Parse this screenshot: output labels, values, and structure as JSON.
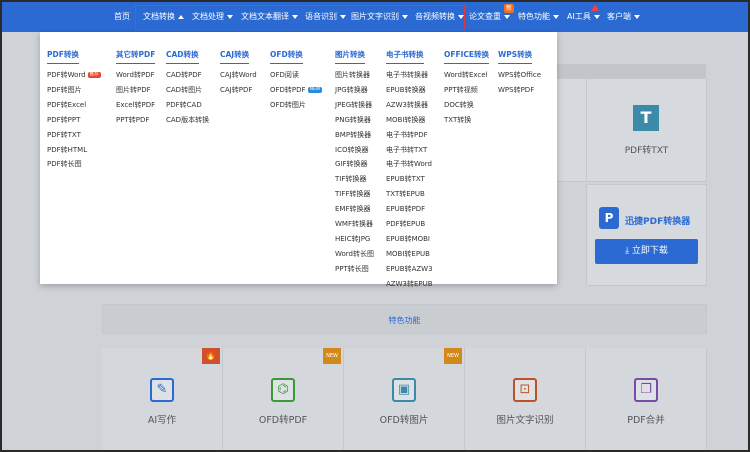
{
  "nav": {
    "items": [
      {
        "label": "首页",
        "arrow": "none"
      },
      {
        "label": "文档转换",
        "arrow": "up"
      },
      {
        "label": "文档处理",
        "arrow": "down"
      },
      {
        "label": "文档文本翻译",
        "arrow": "down"
      },
      {
        "label": "语音识别",
        "arrow": "down"
      },
      {
        "label": "图片文字识别",
        "arrow": "down"
      },
      {
        "label": "音视频转换",
        "arrow": "down"
      },
      {
        "label": "论文查重",
        "arrow": "down"
      },
      {
        "label": "特色功能",
        "arrow": "down"
      },
      {
        "label": "AI工具",
        "arrow": "down"
      },
      {
        "label": "客户端",
        "arrow": "down"
      }
    ],
    "new_badge": "新"
  },
  "dropdown": {
    "columns": [
      {
        "title": "PDF转换",
        "items": [
          "PDF转Word",
          "PDF转图片",
          "PDF转Excel",
          "PDF转PPT",
          "PDF转TXT",
          "PDF转HTML",
          "PDF转长图"
        ],
        "badge": "推荐"
      },
      {
        "title": "其它转PDF",
        "items": [
          "Word转PDF",
          "图片转PDF",
          "Excel转PDF",
          "PPT转PDF"
        ]
      },
      {
        "title": "CAD转换",
        "items": [
          "CAD转PDF",
          "CAD转图片",
          "PDF转CAD",
          "CAD版本转换"
        ]
      },
      {
        "title": "CAJ转换",
        "items": [
          "CAJ转Word",
          "CAJ转PDF"
        ]
      },
      {
        "title": "OFD转换",
        "items": [
          "OFD阅读",
          "OFD转PDF",
          "OFD转图片"
        ],
        "badge": "NEW"
      },
      {
        "title": "图片转换",
        "items": [
          "图片转换器",
          "JPG转换器",
          "JPEG转换器",
          "PNG转换器",
          "BMP转换器",
          "ICO转换器",
          "GIF转换器",
          "TIF转换器",
          "TIFF转换器",
          "EMF转换器",
          "WMF转换器",
          "HEIC转JPG",
          "Word转长图",
          "PPT转长图"
        ]
      },
      {
        "title": "电子书转换",
        "items": [
          "电子书转换器",
          "EPUB转换器",
          "AZW3转换器",
          "MOBI转换器",
          "电子书转PDF",
          "电子书转TXT",
          "电子书转Word",
          "EPUB转TXT",
          "TXT转EPUB",
          "EPUB转PDF",
          "PDF转EPUB",
          "EPUB转MOBI",
          "MOBI转EPUB",
          "EPUB转AZW3",
          "AZW3转EPUB"
        ]
      },
      {
        "title": "OFFICE转换",
        "items": [
          "Word转Excel",
          "PPT转视频",
          "DOC转换",
          "TXT转换"
        ]
      },
      {
        "title": "WPS转换",
        "items": [
          "WPS转Office",
          "WPS转PDF"
        ]
      }
    ]
  },
  "background": {
    "right_card_label": "PDF转TXT",
    "promo_title": "迅捷PDF转换器",
    "promo_button": "立即下载",
    "section_title": "特色功能",
    "tiles": [
      {
        "label": "AI写作",
        "icon": "pen-icon",
        "color": "#2a6ad2",
        "tag": "hot"
      },
      {
        "label": "OFD转PDF",
        "icon": "pdf-icon",
        "color": "#3a9a3a",
        "tag": "NEW"
      },
      {
        "label": "OFD转图片",
        "icon": "image-icon",
        "color": "#3b8aa8",
        "tag": "NEW"
      },
      {
        "label": "图片文字识别",
        "icon": "scan-icon",
        "color": "#c0502a",
        "tag": ""
      },
      {
        "label": "PDF合并",
        "icon": "merge-icon",
        "color": "#7a4aa8",
        "tag": ""
      }
    ]
  }
}
